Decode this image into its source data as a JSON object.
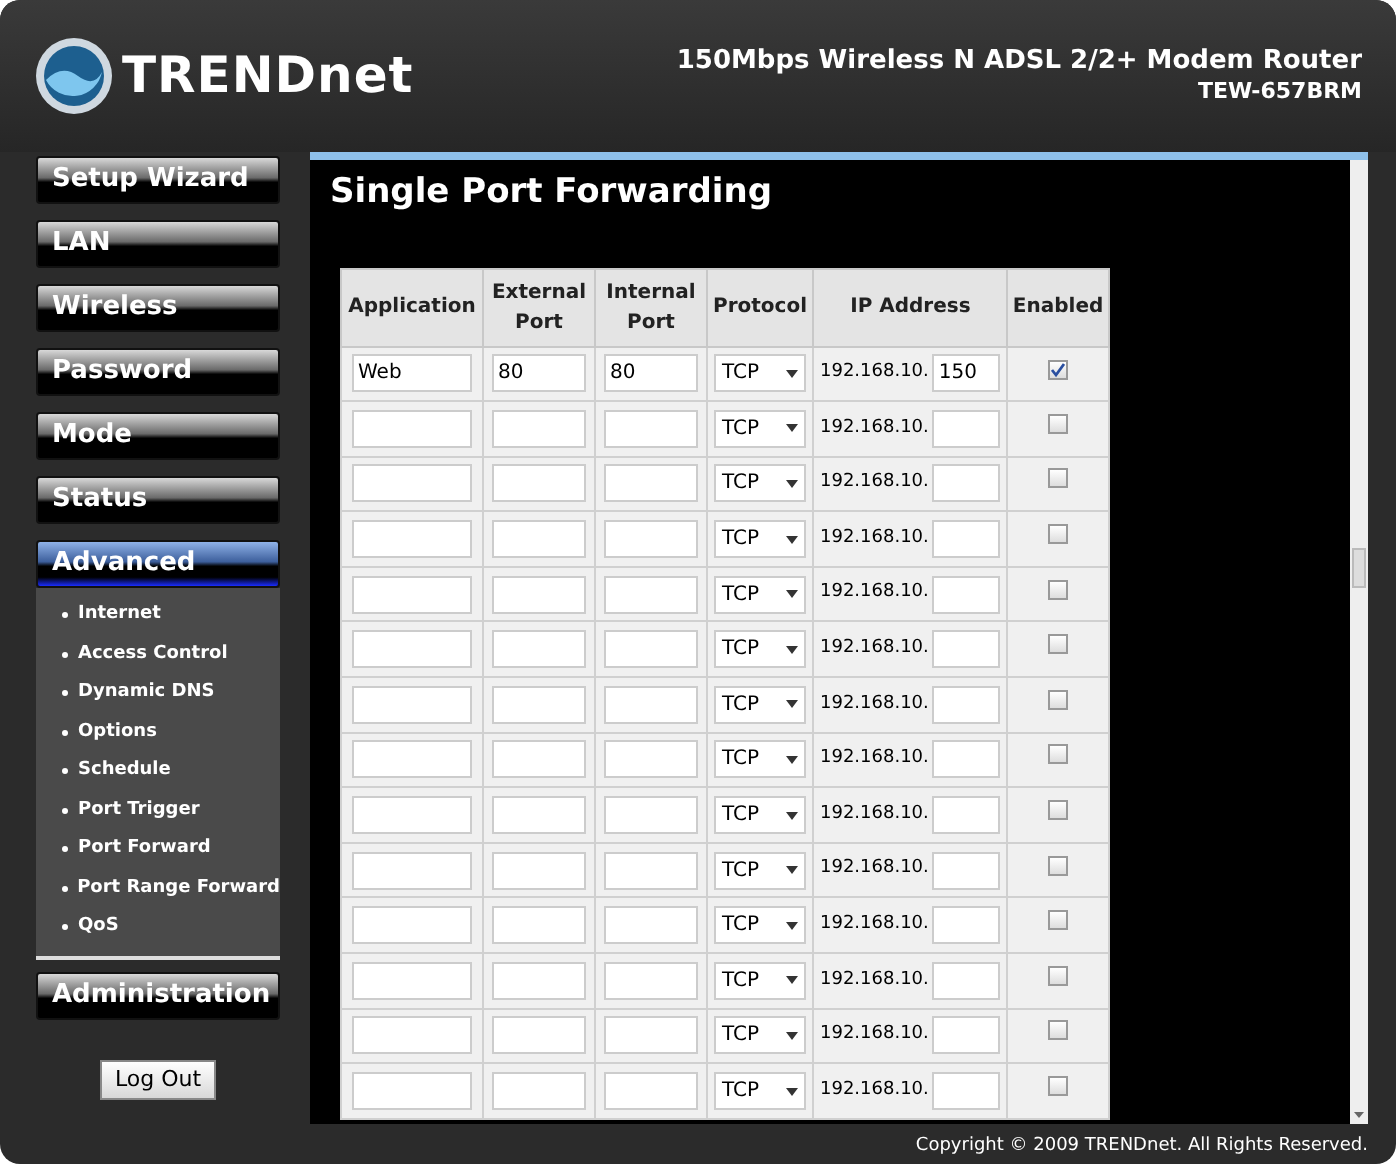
{
  "header": {
    "logo": "TRENDnet",
    "product": "150Mbps Wireless N ADSL 2/2+ Modem Router",
    "model": "TEW-657BRM"
  },
  "sidebar": {
    "items": [
      {
        "label": "Setup Wizard",
        "selected": false
      },
      {
        "label": "LAN",
        "selected": false
      },
      {
        "label": "Wireless",
        "selected": false
      },
      {
        "label": "Password",
        "selected": false
      },
      {
        "label": "Mode",
        "selected": false
      },
      {
        "label": "Status",
        "selected": false
      },
      {
        "label": "Advanced",
        "selected": true,
        "children": [
          {
            "label": "Internet"
          },
          {
            "label": "Access Control"
          },
          {
            "label": "Dynamic DNS"
          },
          {
            "label": "Options"
          },
          {
            "label": "Schedule"
          },
          {
            "label": "Port Trigger"
          },
          {
            "label": "Port Forward"
          },
          {
            "label": "Port Range Forward"
          },
          {
            "label": "QoS"
          }
        ]
      },
      {
        "label": "Administration",
        "selected": false
      }
    ],
    "logout": "Log Out"
  },
  "page": {
    "title": "Single Port Forwarding",
    "table": {
      "columns": [
        "Application",
        "External Port",
        "Internal Port",
        "Protocol",
        "IP Address",
        "Enabled"
      ],
      "rows": [
        {
          "application": "Web",
          "external_port": "80",
          "internal_port": "80",
          "protocol": "TCP",
          "ip_prefix": "192.168.10.",
          "ip_suffix": "150",
          "enabled": true
        },
        {
          "protocol": "TCP",
          "ip_prefix": "192.168.10.",
          "enabled": false
        },
        {
          "protocol": "TCP",
          "ip_prefix": "192.168.10.",
          "enabled": false
        },
        {
          "protocol": "TCP",
          "ip_prefix": "192.168.10.",
          "enabled": false
        },
        {
          "protocol": "TCP",
          "ip_prefix": "192.168.10.",
          "enabled": false
        },
        {
          "protocol": "TCP",
          "ip_prefix": "192.168.10.",
          "enabled": false
        },
        {
          "protocol": "TCP",
          "ip_prefix": "192.168.10.",
          "enabled": false
        },
        {
          "protocol": "TCP",
          "ip_prefix": "192.168.10.",
          "enabled": false
        },
        {
          "protocol": "TCP",
          "ip_prefix": "192.168.10.",
          "enabled": false
        },
        {
          "protocol": "TCP",
          "ip_prefix": "192.168.10.",
          "enabled": false
        },
        {
          "protocol": "TCP",
          "ip_prefix": "192.168.10.",
          "enabled": false
        },
        {
          "protocol": "TCP",
          "ip_prefix": "192.168.10.",
          "enabled": false
        },
        {
          "protocol": "TCP",
          "ip_prefix": "192.168.10.",
          "enabled": false
        },
        {
          "protocol": "TCP",
          "ip_prefix": "192.168.10.",
          "enabled": false
        }
      ]
    }
  },
  "footer": {
    "copyright": "Copyright © 2009 TRENDnet. All Rights Reserved."
  }
}
